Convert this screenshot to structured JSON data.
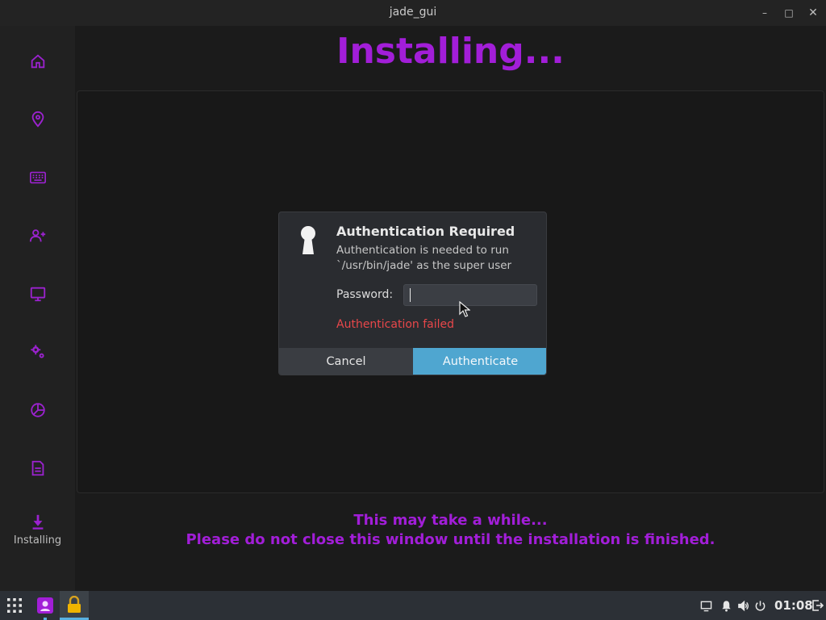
{
  "window": {
    "title": "jade_gui",
    "minimize_glyph": "–",
    "maximize_glyph": "□",
    "close_glyph": "✕"
  },
  "sidebar": {
    "items": [
      {
        "icon": "home-icon"
      },
      {
        "icon": "location-pin-icon"
      },
      {
        "icon": "keyboard-icon"
      },
      {
        "icon": "add-user-icon"
      },
      {
        "icon": "monitor-icon"
      },
      {
        "icon": "settings-gears-icon"
      },
      {
        "icon": "partition-pie-icon"
      },
      {
        "icon": "summary-document-icon"
      },
      {
        "icon": "download-icon",
        "label": "Installing",
        "active": true
      }
    ]
  },
  "main": {
    "heading": "Installing...",
    "message_line1": "This may take a while...",
    "message_line2": "Please do not close this window until the installation is finished."
  },
  "dialog": {
    "title": "Authentication Required",
    "message": "Authentication is needed to run `/usr/bin/jade' as the super user",
    "password_label": "Password:",
    "password_value": "",
    "error": "Authentication failed",
    "cancel_label": "Cancel",
    "authenticate_label": "Authenticate"
  },
  "taskbar": {
    "clock": "01:08"
  },
  "colors": {
    "accent": "#a21ed8",
    "error": "#e8474a",
    "primary_button": "#4fa6d0"
  }
}
